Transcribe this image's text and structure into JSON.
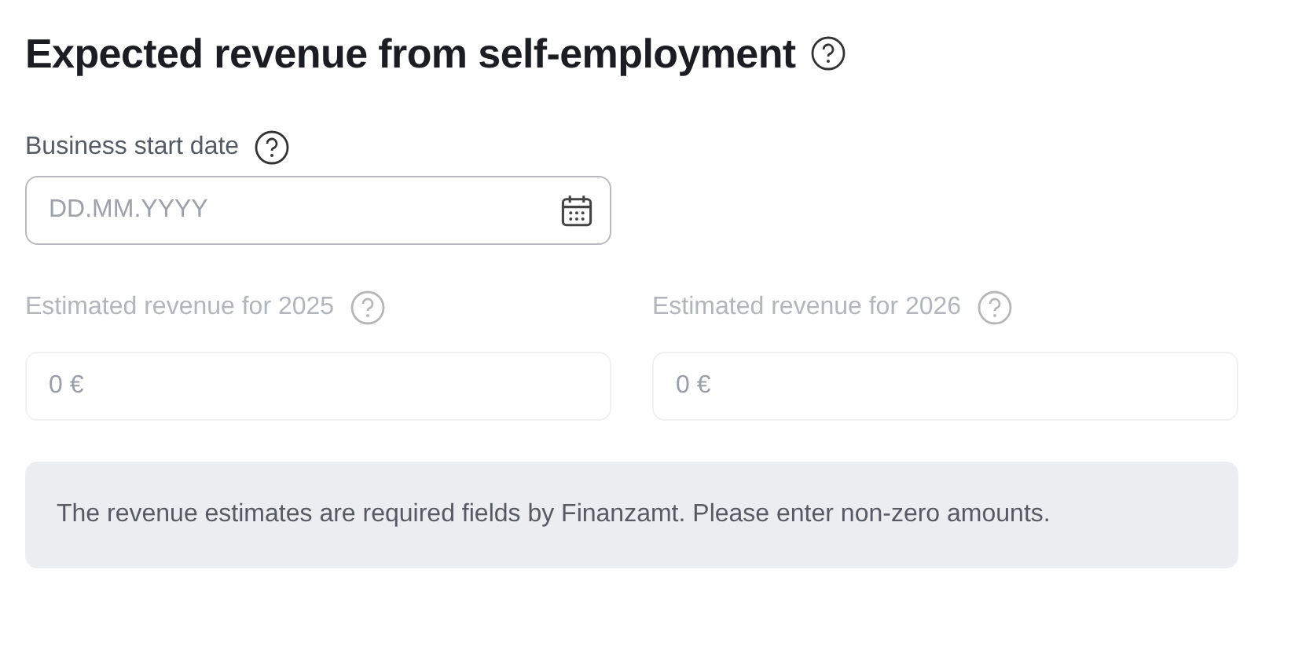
{
  "title": "Expected revenue from self-employment",
  "start_date": {
    "label": "Business start date",
    "placeholder": "DD.MM.YYYY"
  },
  "revenue_fields": [
    {
      "label": "Estimated revenue for 2025",
      "value": "0 €",
      "disabled": true
    },
    {
      "label": "Estimated revenue for 2026",
      "value": "0 €",
      "disabled": true
    }
  ],
  "note": "The revenue estimates are required fields by Finanzamt. Please enter non-zero amounts."
}
